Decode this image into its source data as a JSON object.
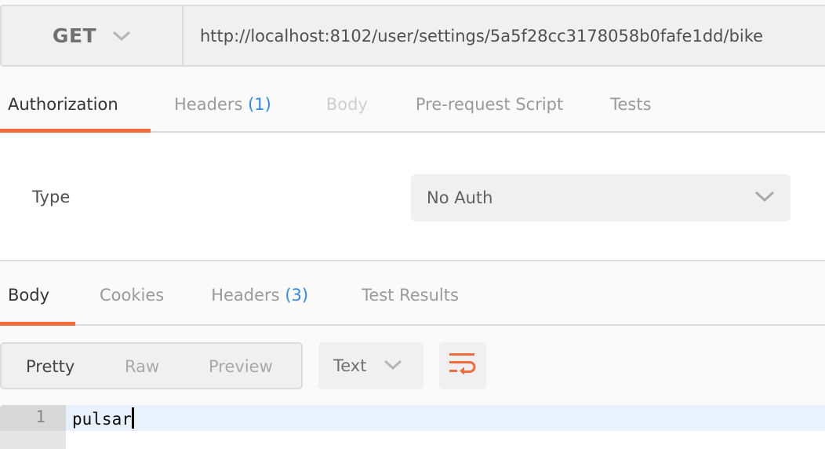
{
  "request": {
    "method": "GET",
    "url": "http://localhost:8102/user/settings/5a5f28cc3178058b0fafe1dd/bike"
  },
  "request_tabs": [
    {
      "label": "Authorization",
      "count": null,
      "state": "active"
    },
    {
      "label": "Headers",
      "count": "(1)",
      "state": "normal"
    },
    {
      "label": "Body",
      "count": null,
      "state": "disabled"
    },
    {
      "label": "Pre-request Script",
      "count": null,
      "state": "normal"
    },
    {
      "label": "Tests",
      "count": null,
      "state": "normal"
    }
  ],
  "auth": {
    "type_label": "Type",
    "selected": "No Auth"
  },
  "response_tabs": [
    {
      "label": "Body",
      "count": null,
      "state": "active"
    },
    {
      "label": "Cookies",
      "count": null,
      "state": "normal"
    },
    {
      "label": "Headers",
      "count": "(3)",
      "state": "normal"
    },
    {
      "label": "Test Results",
      "count": null,
      "state": "normal"
    }
  ],
  "response_view": {
    "modes": [
      "Pretty",
      "Raw",
      "Preview"
    ],
    "active_mode": "Pretty",
    "format": "Text",
    "wrap_icon": "wrap-lines-icon"
  },
  "editor": {
    "lines": [
      {
        "number": "1",
        "text": "pulsar"
      }
    ]
  },
  "colors": {
    "accent": "#f26b3a",
    "count_badge": "#2d8ceb"
  }
}
